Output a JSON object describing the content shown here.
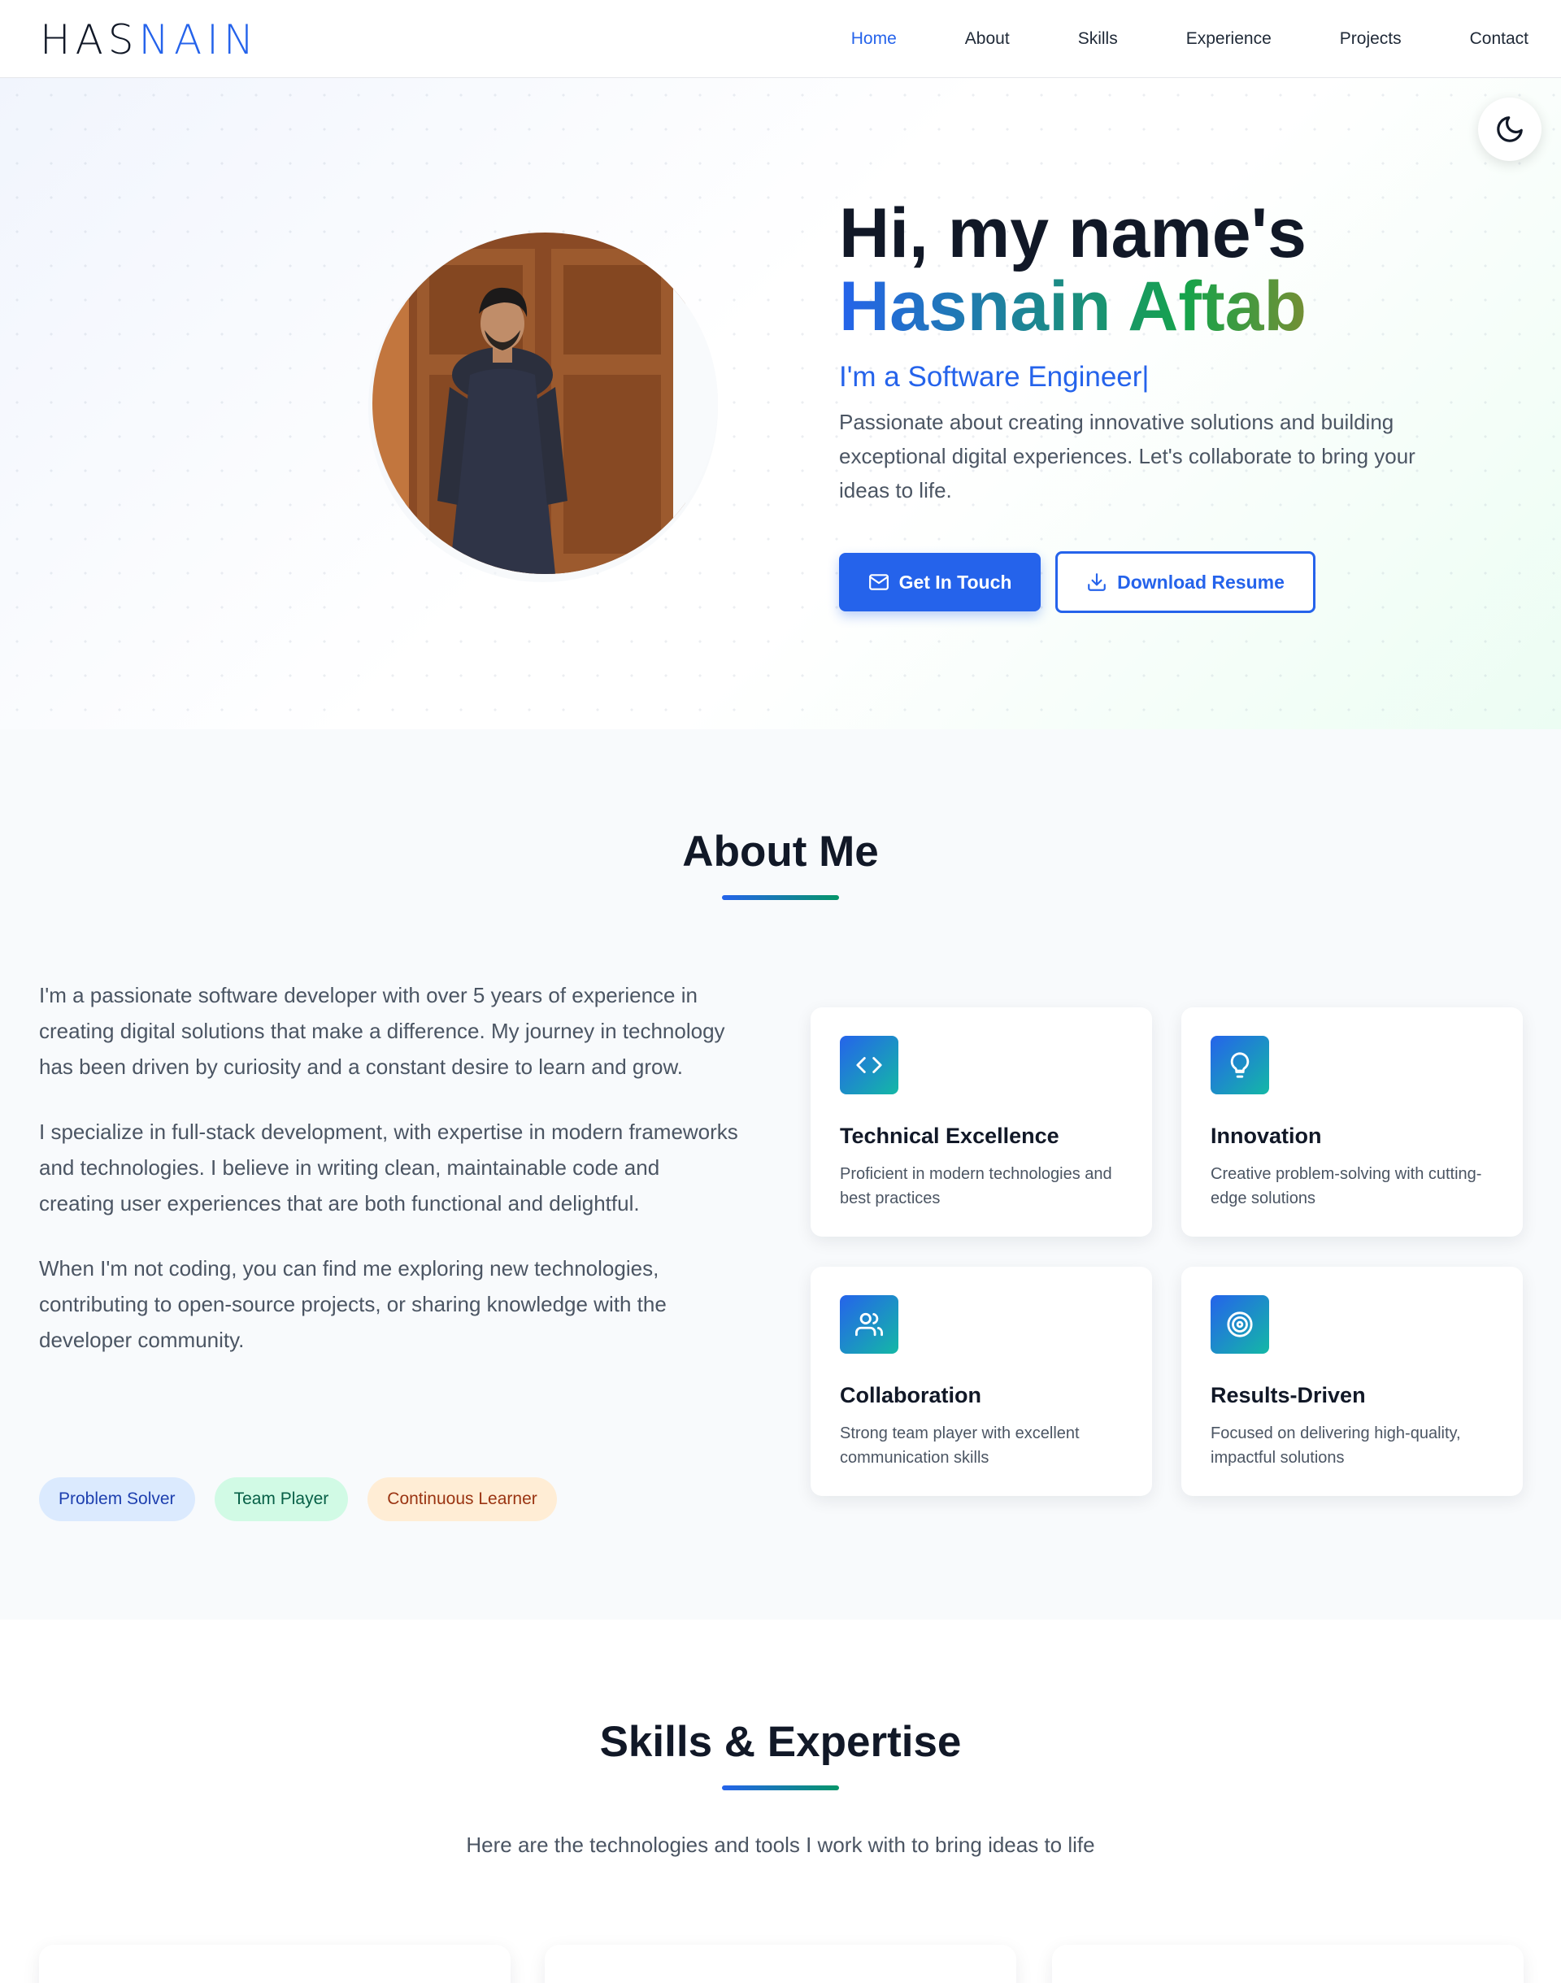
{
  "nav": {
    "logo_part1": "HAS",
    "logo_part2": "NAIN",
    "links": [
      "Home",
      "About",
      "Skills",
      "Experience",
      "Projects",
      "Contact"
    ],
    "active": "Home"
  },
  "hero": {
    "greeting": "Hi, my name's",
    "name": "Hasnain Aftab",
    "role": "I'm a Software Engineer|",
    "tagline": "Passionate about creating innovative solutions and building exceptional digital experiences. Let's collaborate to bring your ideas to life.",
    "primary_button": "Get In Touch",
    "secondary_button": "Download Resume",
    "theme_toggle_icon": "moon-icon"
  },
  "about": {
    "title": "About Me",
    "paragraphs": [
      "I'm a passionate software developer with over 5 years of experience in creating digital solutions that make a difference. My journey in technology has been driven by curiosity and a constant desire to learn and grow.",
      "I specialize in full-stack development, with expertise in modern frameworks and technologies. I believe in writing clean, maintainable code and creating user experiences that are both functional and delightful.",
      "When I'm not coding, you can find me exploring new technologies, contributing to open-source projects, or sharing knowledge with the developer community."
    ],
    "pills": [
      "Problem Solver",
      "Team Player",
      "Continuous Learner"
    ],
    "cards": [
      {
        "title": "Technical Excellence",
        "desc": "Proficient in modern technologies and best practices",
        "icon": "code-icon"
      },
      {
        "title": "Innovation",
        "desc": "Creative problem-solving with cutting-edge solutions",
        "icon": "lightbulb-icon"
      },
      {
        "title": "Collaboration",
        "desc": "Strong team player with excellent communication skills",
        "icon": "users-icon"
      },
      {
        "title": "Results-Driven",
        "desc": "Focused on delivering high-quality, impactful solutions",
        "icon": "target-icon"
      }
    ]
  },
  "skills": {
    "title": "Skills & Expertise",
    "subtitle": "Here are the technologies and tools I work with to bring ideas to life"
  },
  "colors": {
    "accent": "#2563eb",
    "accent_secondary": "#059669",
    "name_gradient_end": "#f97316"
  }
}
